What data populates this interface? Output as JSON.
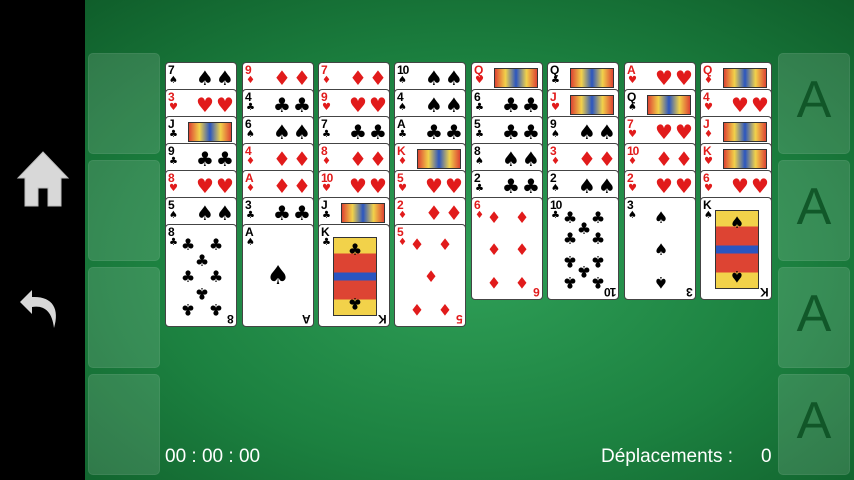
{
  "sidebar": {
    "home_icon": "home-icon",
    "undo_icon": "undo-icon"
  },
  "free_cells": [
    {
      "id": 1
    },
    {
      "id": 2
    },
    {
      "id": 3
    },
    {
      "id": 4
    }
  ],
  "foundations": [
    {
      "label": "A"
    },
    {
      "label": "A"
    },
    {
      "label": "A"
    },
    {
      "label": "A"
    }
  ],
  "columns": [
    [
      {
        "rank": "7",
        "suit": "♠",
        "color": "black"
      },
      {
        "rank": "3",
        "suit": "♥",
        "color": "red"
      },
      {
        "rank": "J",
        "suit": "♣",
        "color": "black"
      },
      {
        "rank": "9",
        "suit": "♣",
        "color": "black"
      },
      {
        "rank": "8",
        "suit": "♥",
        "color": "red"
      },
      {
        "rank": "5",
        "suit": "♠",
        "color": "black"
      },
      {
        "rank": "8",
        "suit": "♣",
        "color": "black"
      }
    ],
    [
      {
        "rank": "9",
        "suit": "♦",
        "color": "red"
      },
      {
        "rank": "4",
        "suit": "♣",
        "color": "black"
      },
      {
        "rank": "6",
        "suit": "♠",
        "color": "black"
      },
      {
        "rank": "4",
        "suit": "♦",
        "color": "red"
      },
      {
        "rank": "A",
        "suit": "♦",
        "color": "red"
      },
      {
        "rank": "3",
        "suit": "♣",
        "color": "black"
      },
      {
        "rank": "A",
        "suit": "♠",
        "color": "black"
      }
    ],
    [
      {
        "rank": "7",
        "suit": "♦",
        "color": "red"
      },
      {
        "rank": "9",
        "suit": "♥",
        "color": "red"
      },
      {
        "rank": "7",
        "suit": "♣",
        "color": "black"
      },
      {
        "rank": "8",
        "suit": "♦",
        "color": "red"
      },
      {
        "rank": "10",
        "suit": "♥",
        "color": "red"
      },
      {
        "rank": "J",
        "suit": "♣",
        "color": "black"
      },
      {
        "rank": "K",
        "suit": "♣",
        "color": "black"
      }
    ],
    [
      {
        "rank": "10",
        "suit": "♠",
        "color": "black"
      },
      {
        "rank": "4",
        "suit": "♠",
        "color": "black"
      },
      {
        "rank": "A",
        "suit": "♣",
        "color": "black"
      },
      {
        "rank": "K",
        "suit": "♦",
        "color": "red"
      },
      {
        "rank": "5",
        "suit": "♥",
        "color": "red"
      },
      {
        "rank": "2",
        "suit": "♦",
        "color": "red"
      },
      {
        "rank": "5",
        "suit": "♦",
        "color": "red"
      }
    ],
    [
      {
        "rank": "Q",
        "suit": "♥",
        "color": "red"
      },
      {
        "rank": "6",
        "suit": "♣",
        "color": "black"
      },
      {
        "rank": "5",
        "suit": "♣",
        "color": "black"
      },
      {
        "rank": "8",
        "suit": "♠",
        "color": "black"
      },
      {
        "rank": "2",
        "suit": "♣",
        "color": "black"
      },
      {
        "rank": "6",
        "suit": "♦",
        "color": "red"
      }
    ],
    [
      {
        "rank": "Q",
        "suit": "♣",
        "color": "black"
      },
      {
        "rank": "J",
        "suit": "♥",
        "color": "red"
      },
      {
        "rank": "9",
        "suit": "♠",
        "color": "black"
      },
      {
        "rank": "3",
        "suit": "♦",
        "color": "red"
      },
      {
        "rank": "2",
        "suit": "♠",
        "color": "black"
      },
      {
        "rank": "10",
        "suit": "♣",
        "color": "black"
      }
    ],
    [
      {
        "rank": "A",
        "suit": "♥",
        "color": "red"
      },
      {
        "rank": "Q",
        "suit": "♠",
        "color": "black"
      },
      {
        "rank": "7",
        "suit": "♥",
        "color": "red"
      },
      {
        "rank": "10",
        "suit": "♦",
        "color": "red"
      },
      {
        "rank": "2",
        "suit": "♥",
        "color": "red"
      },
      {
        "rank": "3",
        "suit": "♠",
        "color": "black"
      }
    ],
    [
      {
        "rank": "Q",
        "suit": "♦",
        "color": "red"
      },
      {
        "rank": "4",
        "suit": "♥",
        "color": "red"
      },
      {
        "rank": "J",
        "suit": "♦",
        "color": "red"
      },
      {
        "rank": "K",
        "suit": "♥",
        "color": "red"
      },
      {
        "rank": "6",
        "suit": "♥",
        "color": "red"
      },
      {
        "rank": "K",
        "suit": "♠",
        "color": "black"
      }
    ]
  ],
  "status": {
    "timer": "00 : 00 : 00",
    "moves_label": "Déplacements :",
    "moves_value": "0"
  },
  "colors": {
    "felt": "#1c8140",
    "red_suit": "#e11b1b",
    "black_suit": "#000000"
  }
}
